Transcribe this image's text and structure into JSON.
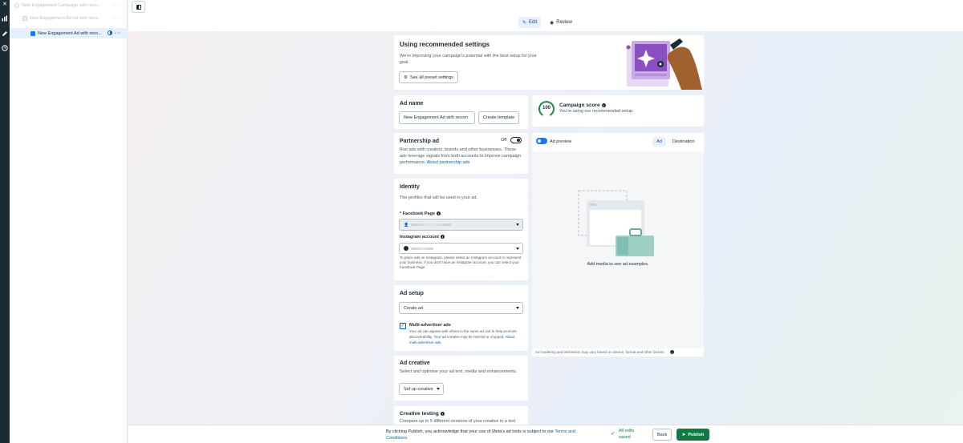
{
  "tree": {
    "items": [
      {
        "label": "New Engagement Campaign with reco..."
      },
      {
        "label": "New Engagement Ad set with reco..."
      },
      {
        "label": "New Engagement Ad with reco..."
      }
    ]
  },
  "tabs": {
    "edit": "Edit",
    "review": "Review"
  },
  "recommended": {
    "title": "Using recommended settings",
    "desc": "We're improving your campaign's potential with the best setup for your goal.",
    "button": "See all preset settings"
  },
  "ad_name": {
    "title": "Ad name",
    "value": "New Engagement Ad with recom",
    "template_button": "Create template"
  },
  "score": {
    "value": "100",
    "title": "Campaign score",
    "desc": "You're using our recommended setup."
  },
  "partnership": {
    "title": "Partnership ad",
    "toggle_label": "Off",
    "desc": "Run ads with creators, brands and other businesses. These ads leverage signals from both accounts to improve campaign performance.",
    "link": "About partnership ads"
  },
  "preview": {
    "label": "Ad preview",
    "tab_ad": "Ad",
    "tab_destination": "Destination",
    "empty": "Add media to see ad examples.",
    "footnote": "Ad rendering and interaction may vary based on device, format and other factors."
  },
  "identity": {
    "title": "Identity",
    "desc": "The profiles that will be used in your ad.",
    "fb_label": "* Facebook Page",
    "ig_label": "Instagram account",
    "note": "To place ads on Instagram, please select an Instagram account to represent your business. If you don't have an Instagram account, you can select your Facebook Page."
  },
  "ad_setup": {
    "title": "Ad setup",
    "select": "Create ad",
    "multi_title": "Multi-advertiser ads",
    "multi_desc": "Your ad can appear with others in the same ad unit to help promote discoverability. Your ad creative may be resized or cropped.",
    "multi_link": "About multi-advertiser ads"
  },
  "ad_creative": {
    "title": "Ad creative",
    "desc": "Select and optimise your ad text, media and enhancements.",
    "button": "Set up creative"
  },
  "creative_testing": {
    "title": "Creative testing",
    "desc": "Compare up to 5 different versions of your creative in a test"
  },
  "footer": {
    "terms_pre": "By clicking Publish, you acknowledge that your use of Meta's ad tools is subject to our ",
    "terms_link": "Terms and Conditions",
    "terms_post": ".",
    "saved_line1": "All edits",
    "saved_line2": "saved",
    "back": "Back",
    "publish": "Publish"
  },
  "colors": {
    "accent": "#1877f2",
    "publish": "#0f7b44",
    "score_ring": "#1a8a4a"
  }
}
